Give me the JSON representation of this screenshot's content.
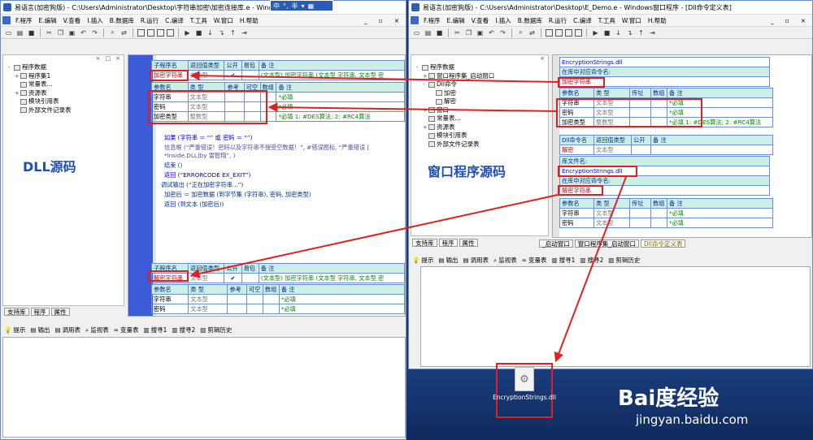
{
  "left": {
    "title": "易语言(加密狗版) - C:\\Users\\Administrator\\Desktop\\字符串加密\\加密连接库.e - Windows...",
    "menu": [
      "F.程序",
      "E.编辑",
      "V.查看",
      "I.插入",
      "B.数据库",
      "R.运行",
      "C.编译",
      "T.工具",
      "W.窗口",
      "H.帮助"
    ],
    "tree_header": [
      "×",
      "□",
      "×"
    ],
    "tree": [
      "程序数据",
      "程序集1",
      "常量表...",
      "资源表",
      "模块引用表",
      "外部文件记录表"
    ],
    "tabs": [
      "支持库",
      "程序",
      "属性"
    ],
    "table1": {
      "head": [
        "子程序名",
        "返回值类型",
        "公开",
        "易包",
        "备 注"
      ],
      "row": [
        "加密字符串",
        "文本型",
        "✔",
        "",
        "(文本型) 加密字符串 (文本型 字符串, 文本型 密"
      ],
      "phead": [
        "参数名",
        "类 型",
        "参考",
        "可空",
        "数组",
        "备 注"
      ],
      "params": [
        [
          "字符串",
          "文本型",
          "*必填"
        ],
        [
          "密码",
          "文本型",
          "*必填"
        ],
        [
          "加密类型",
          "整数型",
          "*必填 1: #DES算法; 2: #RC4算法"
        ]
      ]
    },
    "code": [
      "如果 (字符串 ＝ “” 或 密码 ＝ “”)",
      "信息框 (“严重错误！密码以及字符串不接受空数据！”, #错误图标, “严重错误 [",
      "*Inside.DLL]by 雷智翔”, )",
      "结束 ()",
      "返回 (“ERRORCODE EX_EXIT”)",
      "调试输出 (“正在加密字符串...”)",
      "加密后 ＝ 加密数据 (到字节集 (字符串), 密码, 加密类型)",
      "返回 (到文本 (加密后))"
    ],
    "table2": {
      "head": [
        "子程序名",
        "返回值类型",
        "公开",
        "易包",
        "备 注"
      ],
      "row": [
        "解密字符串",
        "文本型",
        "✔",
        "",
        "(文本型) 加密字符串 (文本型 字符串, 文本型 密"
      ],
      "phead": [
        "参数名",
        "类 型",
        "参考",
        "可空",
        "数组",
        "备 注"
      ],
      "params": [
        [
          "字符串",
          "文本型",
          "*必填"
        ],
        [
          "密码",
          "文本型",
          "*必填"
        ]
      ]
    },
    "big_label": "DLL源码",
    "out_tabs": [
      "提示",
      "输出",
      "调用表",
      "监视表",
      "变量表",
      "搜寻1",
      "搜寻2",
      "剪辑历史"
    ]
  },
  "right": {
    "title": "易语言(加密狗版) - C:\\Users\\Administrator\\Desktop\\E_Demo.e - Windows窗口程序 - [Dll命令定义表]",
    "menu": [
      "F.程序",
      "E.编辑",
      "V.查看",
      "I.插入",
      "B.数据库",
      "R.运行",
      "C.编译",
      "T.工具",
      "W.窗口",
      "H.帮助"
    ],
    "tree": [
      "程序数据",
      "窗口程序集_启动窗口",
      "Dll命令",
      "加密",
      "解密",
      "窗口",
      "常量表...",
      "资源表",
      "模块引用表",
      "外部文件记录表"
    ],
    "tabs": [
      "支持库",
      "程序",
      "属性"
    ],
    "doc_tabs": [
      "_启动窗口",
      "窗口程序集_启动窗口",
      "Dll命令定义表"
    ],
    "dll1": {
      "lib": "EncryptionStrings.dll",
      "cmd_label": "在库中对应命令名:",
      "cmd": "加密字符串",
      "phead": [
        "参数名",
        "类 型",
        "传址",
        "数组",
        "备 注"
      ],
      "params": [
        [
          "字符串",
          "文本型",
          "*必填"
        ],
        [
          "密码",
          "文本型",
          "*必填"
        ],
        [
          "加密类型",
          "整数型",
          "*必填 1: #DES算法; 2: #RC4算法"
        ]
      ]
    },
    "dll2": {
      "head": [
        "Dll命令名",
        "返回值类型",
        "公开",
        "备 注"
      ],
      "name": "解密",
      "type": "文本型",
      "lib_label": "库文件名:",
      "lib": "EncryptionStrings.dll",
      "cmd_label": "在库中对应命令名:",
      "cmd": "解密字符串",
      "phead": [
        "参数名",
        "类 型",
        "传址",
        "数组",
        "备 注"
      ],
      "params": [
        [
          "字符串",
          "文本型",
          "*必填"
        ],
        [
          "密码",
          "文本型",
          "*必填"
        ]
      ]
    },
    "big_label": "窗口程序源码",
    "out_tabs": [
      "提示",
      "输出",
      "调用表",
      "监视表",
      "变量表",
      "搜寻1",
      "搜寻2",
      "剪辑历史"
    ]
  },
  "ime": [
    "中",
    "°,",
    "半"
  ],
  "desktop": {
    "file_name": "EncryptionStrings.dll",
    "brand": "Bai度经验",
    "brand_sub": "jingyan.baidu.com"
  },
  "colors": {
    "highlight": "#e02020",
    "label": "#1f4fb4",
    "gutter": "#3b5bd8"
  }
}
